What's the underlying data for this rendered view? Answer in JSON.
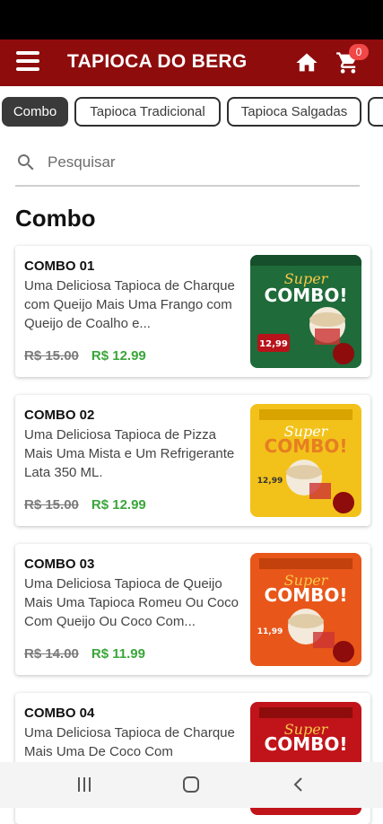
{
  "app": {
    "title": "TAPIOCA DO BERG",
    "cart_count": "0"
  },
  "categories": [
    "Combo",
    "Tapioca Tradicional",
    "Tapioca Salgadas"
  ],
  "search": {
    "placeholder": "Pesquisar"
  },
  "section": {
    "title": "Combo"
  },
  "products": [
    {
      "name": "COMBO 01",
      "description": "Uma Deliciosa Tapioca de Charque com Queijo Mais Uma Frango com Queijo de Coalho e...",
      "old_price": "R$ 15.00",
      "price": "R$ 12.99"
    },
    {
      "name": "COMBO 02",
      "description": "Uma Deliciosa Tapioca de Pizza Mais Uma Mista e Um Refrigerante Lata 350 ML.",
      "old_price": "R$ 15.00",
      "price": "R$ 12.99"
    },
    {
      "name": "COMBO 03",
      "description": "Uma Deliciosa Tapioca de Queijo Mais Uma Tapioca Romeu Ou Coco Com Queijo Ou Coco Com...",
      "old_price": "R$ 14.00",
      "price": "R$ 11.99"
    },
    {
      "name": "COMBO 04",
      "description": "Uma Deliciosa Tapioca de Charque Mais Uma De Coco Com",
      "old_price": "",
      "price": ""
    }
  ],
  "promo_images": [
    {
      "super": "Super",
      "combo": "COMBO!",
      "price": "12,99",
      "bg": "#1f6b3a"
    },
    {
      "super": "Super",
      "combo": "COMBO!",
      "price": "12,99",
      "bg": "#f2c21a"
    },
    {
      "super": "Super",
      "combo": "COMBO!",
      "price": "11,99",
      "bg": "#e8561a"
    },
    {
      "super": "Super",
      "combo": "COMBO!",
      "price": "",
      "bg": "#c0141a"
    }
  ],
  "colors": {
    "app_bar": "#8e0c0c",
    "new_price": "#3aa63a",
    "badge": "#f04747"
  }
}
